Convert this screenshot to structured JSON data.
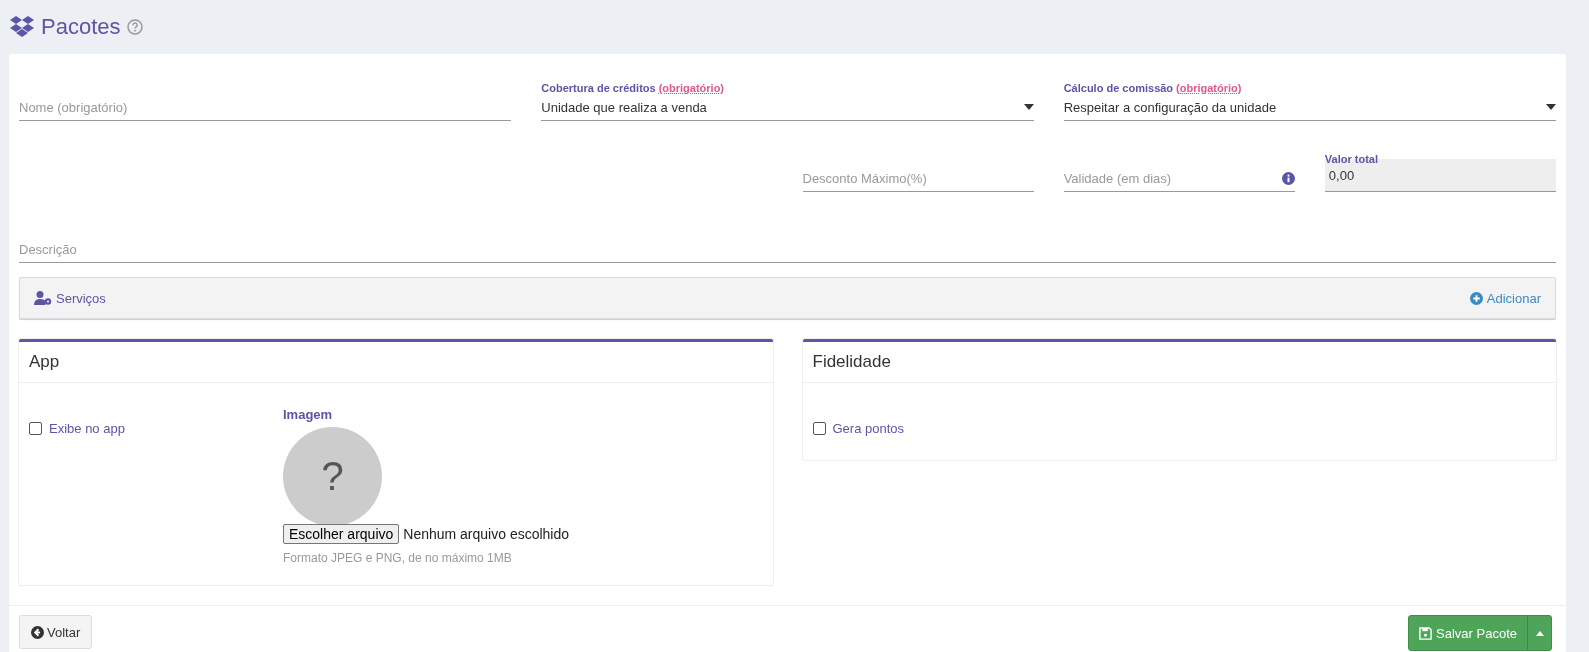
{
  "header": {
    "title": "Pacotes"
  },
  "fields_row1": [
    {
      "kind": "text",
      "placeholder": "Nome (obrigatório)"
    },
    {
      "kind": "select",
      "label": "Cobertura de créditos",
      "note": "(obrigatório)",
      "value": "Unidade que realiza a venda"
    },
    {
      "kind": "select",
      "label": "Cálculo de comissão",
      "note": "(obrigatório)",
      "value": "Respeitar a configuração da unidade"
    }
  ],
  "fields_row2": [
    {
      "kind": "text",
      "placeholder": "Desconto Máximo(%)"
    },
    {
      "kind": "info-text",
      "placeholder": "Validade (em dias)"
    },
    {
      "kind": "readonly",
      "label": "Valor total",
      "value": "0,00"
    }
  ],
  "description": {
    "kind": "text",
    "placeholder": "Descrição"
  },
  "services_bar": {
    "label": "Serviços",
    "action": "Adicionar"
  },
  "panels": [
    {
      "title": "App",
      "checkbox": {
        "label": "Exibe no app",
        "checked": false
      },
      "image": {
        "label": "Imagem",
        "mark": "?",
        "button": "Escolher arquivo",
        "status": "Nenhum arquivo escolhido",
        "hint": "Formato JPEG e PNG, de no máximo 1MB"
      }
    },
    {
      "title": "Fidelidade",
      "checkbox": {
        "label": "Gera pontos",
        "checked": false
      }
    }
  ],
  "footer": {
    "back_button": "Voltar",
    "save_button": "Salvar Pacote"
  }
}
